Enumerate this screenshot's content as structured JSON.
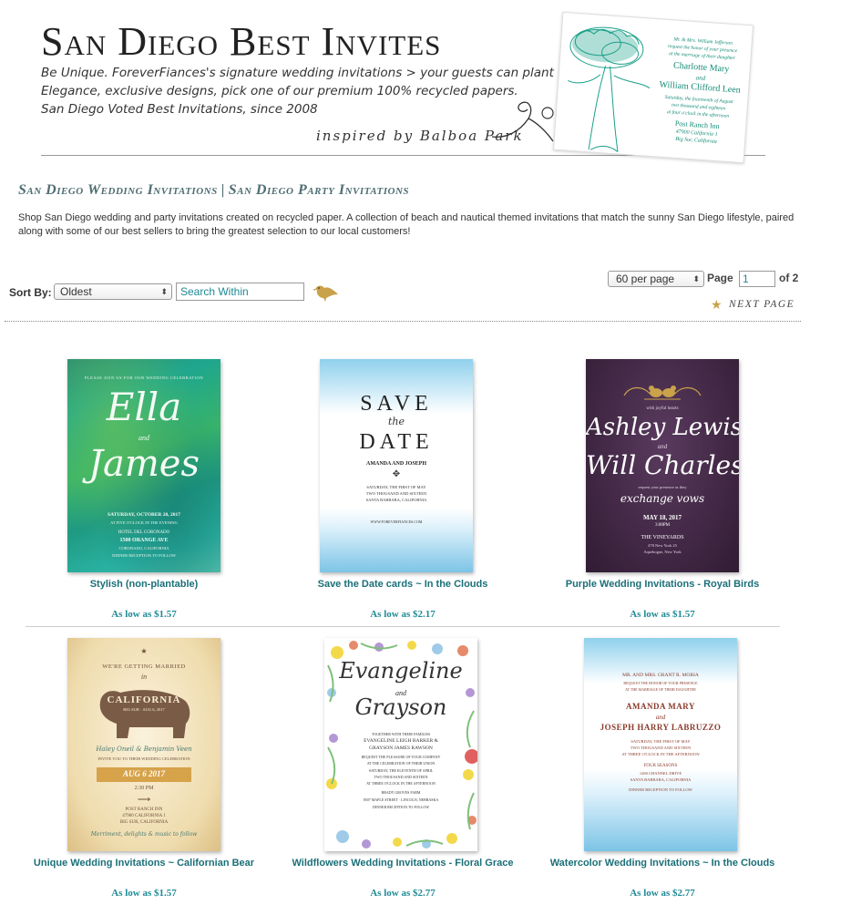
{
  "banner": {
    "title": "San Diego Best Invites",
    "tagline1": "Be Unique. ForeverFiances's signature wedding invitations > your guests can plant into wildflowers",
    "tagline2": "Elegance, exclusive designs, pick one of our premium 100% recycled papers.",
    "tagline3": "San Diego Voted Best Invitations, since 2008",
    "inspired": "inspired by Balboa Park",
    "card": {
      "line1": "Mr. & Mrs. William Jefferson",
      "line2": "request the honor of your presence",
      "line3": "at the marriage of their daughter",
      "name1": "Charlotte Mary",
      "and": "and",
      "name2": "William Clifford Leen",
      "line4": "Saturday, the fourteenth of August",
      "line5": "two thousand and eighteen",
      "line6": "at four o'clock in the afternoon",
      "venue": "Post Ranch Inn",
      "addr": "47900 California 1",
      "city": "Big Sur, California"
    }
  },
  "section": {
    "link1": "San Diego Wedding Invitations",
    "separator": "|",
    "link2": "San Diego Party Invitations",
    "description": "Shop San Diego wedding and party invitations created on recycled paper. A collection of beach and nautical themed invitations that match the sunny San Diego lifestyle, paired along with some of our best sellers to bring the greatest selection to our local customers!"
  },
  "controls": {
    "sort_label": "Sort By:",
    "sort_value": "Oldest",
    "search_placeholder": "Search Within",
    "per_page": "60 per page",
    "page_label": "Page",
    "page_value": "1",
    "of_label": "of 2",
    "next_page": "NEXT PAGE"
  },
  "products": [
    {
      "name": "Stylish (non-plantable)",
      "price": "As low as $1.57",
      "art": {
        "top": "PLEASE JOIN US FOR OUR WEDDING CELEBRATION",
        "n1": "Ella",
        "and": "and",
        "n2": "James",
        "date": "SATURDAY, OCTOBER 20, 2017",
        "time": "AT FIVE O'CLOCK IN THE EVENING",
        "venue": "HOTEL DEL CORONADO",
        "addr": "1500 ORANGE AVE",
        "city": "CORONADO, CALIFORNIA",
        "recep": "DINNER RECEPTION TO FOLLOW"
      }
    },
    {
      "name": "Save the Date cards ~ In the Clouds",
      "price": "As low as $2.17",
      "art": {
        "save": "SAVE",
        "the": "the",
        "date": "DATE",
        "names": "AMANDA AND JOSEPH",
        "d1": "SATURDAY, THE FIRST OF MAY",
        "d2": "TWO THOUSAND AND SIXTEEN",
        "d3": "SANTA BARBARA, CALIFORNIA",
        "url": "WWW.FOREVERFIANCES.COM"
      }
    },
    {
      "name": "Purple Wedding Invitations - Royal Birds",
      "price": "As low as $1.57",
      "art": {
        "top": "with joyful hearts",
        "n1": "Ashley Lewis",
        "and": "and",
        "n2": "Will Charles",
        "req1": "request your presence as they",
        "vows": "exchange vows",
        "date": "MAY 18, 2017",
        "time": "3:00PM",
        "venue": "THE VINEYARDS",
        "addr": "478 New York 25",
        "city": "Aquebogue, New York"
      }
    },
    {
      "name": "Unique Wedding Invitations ~ Californian Bear",
      "price": "As low as $1.57",
      "art": {
        "top": "WE'RE GETTING MARRIED",
        "in": "in",
        "state": "CALIFORNIA",
        "sub": "BIG SUR · AUG 6, 2017",
        "names": "Haley Oneil & Benjamin Veen",
        "invite": "INVITE YOU TO THEIR WEDDING CELEBRATION",
        "date": "AUG 6 2017",
        "time": "2:30 PM",
        "venue": "POST RANCH INN",
        "addr": "47900 CALIFORNIA 1",
        "city": "BIG SUR, CALIFORNIA",
        "foot": "Merriment, delights & music to follow"
      }
    },
    {
      "name": "Wildflowers Wedding Invitations - Floral Grace",
      "price": "As low as $2.77",
      "art": {
        "n1": "Evangeline",
        "and": "and",
        "n2": "Grayson",
        "l1": "TOGETHER WITH THEIR FAMILIES",
        "l2": "EVANGELINE LEIGH BARKER &",
        "l3": "GRAYSON JAMES RAWSON",
        "l4": "REQUEST THE PLEASURE OF YOUR COMPANY",
        "l5": "AT THE CELEBRATION OF THEIR UNION",
        "l6": "SATURDAY, THE ELEVENTH OF APRIL",
        "l7": "TWO THOUSAND AND SIXTEEN",
        "l8": "AT THREE O'CLOCK IN THE AFTERNOON",
        "l9": "BRADY GROVES FARM",
        "l10": "8507 MAPLE STREET · LINCOLN, NEBRASKA",
        "l11": "DINNER RECEPTION TO FOLLOW"
      }
    },
    {
      "name": "Watercolor Wedding Invitations ~ In the Clouds",
      "price": "As low as $2.77",
      "art": {
        "l1": "MR. AND MRS. GRANT R. MORIA",
        "l2": "REQUEST THE HONOR OF YOUR PRESENCE",
        "l3": "AT THE MARRIAGE OF THEIR DAUGHTER",
        "n1": "AMANDA MARY",
        "and": "and",
        "n2": "JOSEPH HARRY LABRUZZO",
        "d1": "SATURDAY, THE FIRST OF MAY",
        "d2": "TWO THOUSAND AND SIXTEEN",
        "d3": "AT THREE O'CLOCK IN THE AFTERNOON",
        "v1": "FOUR SEASONS",
        "v2": "1260 CHANNEL DRIVE",
        "v3": "SANTA BARBARA, CALIFORNIA",
        "recep": "DINNER RECEPTION TO FOLLOW"
      }
    }
  ]
}
